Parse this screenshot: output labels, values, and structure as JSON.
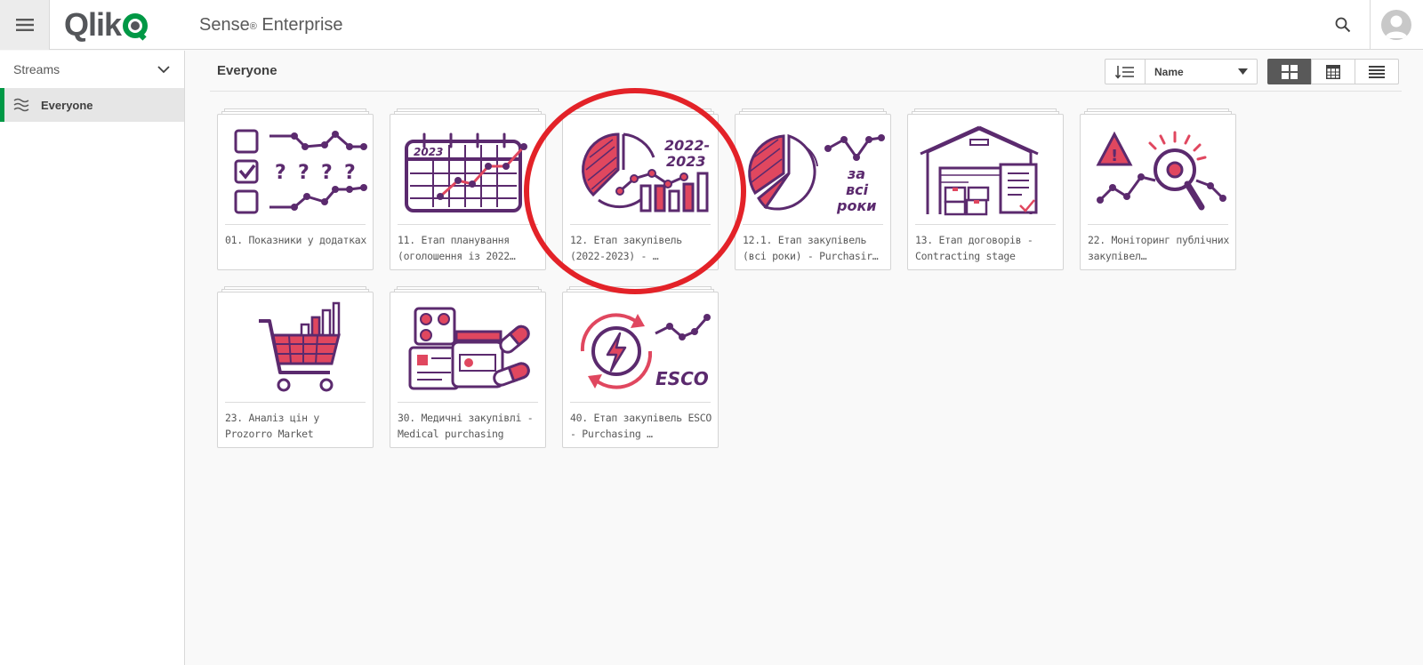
{
  "header": {
    "logo_text": "Qlik",
    "product_name": "Sense",
    "product_mark": "®",
    "product_suffix": " Enterprise",
    "icons": {
      "menu": "hamburger-menu-icon",
      "search": "search-icon",
      "user": "user-avatar-icon"
    }
  },
  "sidebar": {
    "streams_label": "Streams",
    "items": [
      {
        "label": "Everyone",
        "icon": "stream-icon",
        "selected": true
      }
    ]
  },
  "main": {
    "title": "Everyone",
    "sort": {
      "selected": "Name"
    },
    "view_modes": [
      "grid",
      "table",
      "list"
    ],
    "active_view": "grid",
    "apps": [
      {
        "title": "01. Показники у додатках",
        "thumb": "checklist"
      },
      {
        "title": "11. Етап планування (оголошення із 2022…",
        "thumb": "calendar"
      },
      {
        "title": "12. Етап закупівель (2022-2023) -           …",
        "thumb": "pie2022"
      },
      {
        "title": "12.1. Етап закупівель (всі роки) - Purchasir…",
        "thumb": "pieall"
      },
      {
        "title": "13. Етап договорів - Contracting stage",
        "thumb": "warehouse"
      },
      {
        "title": "22. Моніторинг публічних закупівел…",
        "thumb": "monitor"
      },
      {
        "title": "23. Аналіз цін у Prozorro Market",
        "thumb": "cart"
      },
      {
        "title": "30. Медичні закупівлі - Medical purchasing",
        "thumb": "medical"
      },
      {
        "title": "40. Етап закупівель ESCO - Purchasing      …",
        "thumb": "esco"
      }
    ],
    "thumb_text": {
      "calendar_year": "2023",
      "pie_years": "2022-\n2023",
      "pie_years_line1": "2022-",
      "pie_years_line2": "2023",
      "all_years_1": "за",
      "all_years_2": "всі",
      "all_years_3": "роки",
      "esco": "ESCO"
    }
  },
  "colors": {
    "accent_green": "#009845",
    "purple": "#5b2a6e",
    "pink": "#e0475f",
    "annotation_red": "#e32228"
  }
}
